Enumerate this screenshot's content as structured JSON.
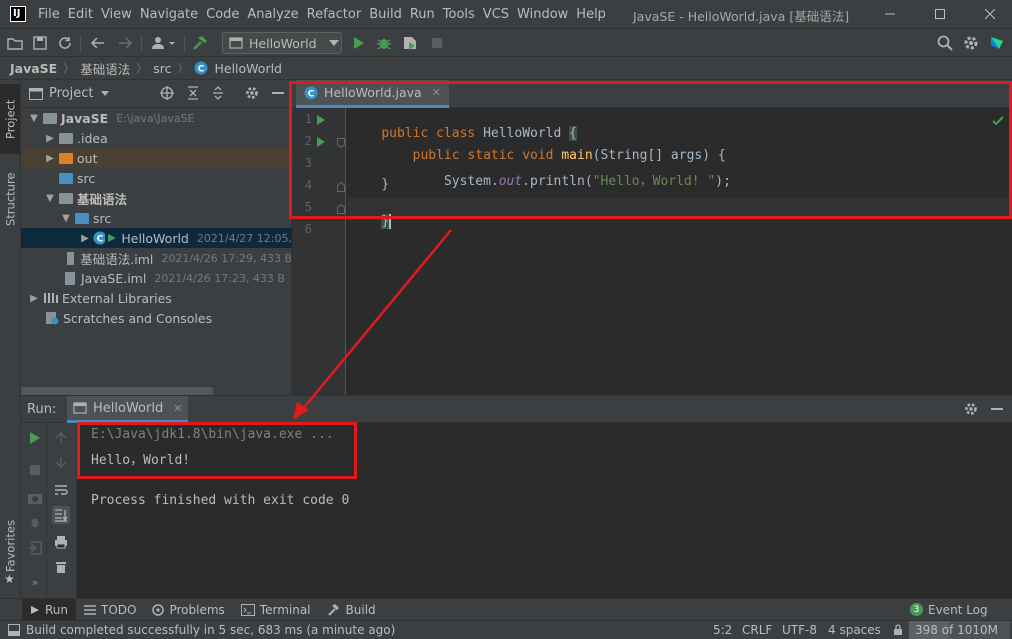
{
  "menu": {
    "items": [
      "File",
      "Edit",
      "View",
      "Navigate",
      "Code",
      "Analyze",
      "Refactor",
      "Build",
      "Run",
      "Tools",
      "VCS",
      "Window",
      "Help"
    ],
    "window_title": "JavaSE - HelloWorld.java [基础语法]"
  },
  "toolbar": {
    "run_config": "HelloWorld"
  },
  "breadcrumb": [
    "JavaSE",
    "基础语法",
    "src",
    "HelloWorld"
  ],
  "left_stripe": {
    "project": "Project",
    "structure": "Structure",
    "favorites": "Favorites"
  },
  "project": {
    "header": "Project",
    "rows": [
      {
        "name": "JavaSE",
        "meta": "E:\\java\\JavaSE"
      },
      {
        "name": ".idea",
        "meta": ""
      },
      {
        "name": "out",
        "meta": ""
      },
      {
        "name": "src",
        "meta": ""
      },
      {
        "name": "基础语法",
        "meta": ""
      },
      {
        "name": "src",
        "meta": ""
      },
      {
        "name": "HelloWorld",
        "meta": "2021/4/27 12:05,"
      },
      {
        "name": "基础语法.iml",
        "meta": "2021/4/26 17:29, 433 B"
      },
      {
        "name": "JavaSE.iml",
        "meta": "2021/4/26 17:23, 433 B"
      },
      {
        "name": "External Libraries",
        "meta": ""
      },
      {
        "name": "Scratches and Consoles",
        "meta": ""
      }
    ]
  },
  "editor": {
    "tab": "HelloWorld.java",
    "line_numbers": [
      "1",
      "2",
      "3",
      "4",
      "5",
      "6"
    ],
    "code": {
      "l1_kw": "public class ",
      "l1_name": "HelloWorld ",
      "l1_brace": "{",
      "l2_indent": "    ",
      "l2_kw": "public static void ",
      "l2_fn": "main",
      "l2_rest": "(String[] args) {",
      "l3_indent": "        ",
      "l3_sys": "System.",
      "l3_out": "out",
      "l3_call": ".println(",
      "l3_str": "\"Hello，World! \"",
      "l3_end": ");",
      "l4": "    }",
      "l5": "}"
    }
  },
  "run": {
    "label": "Run:",
    "tab": "HelloWorld",
    "lines": [
      "E:\\Java\\jdk1.8\\bin\\java.exe ...",
      "Hello，World!",
      "Process finished with exit code 0"
    ]
  },
  "bottom_tools": {
    "run": "Run",
    "todo": "TODO",
    "problems": "Problems",
    "terminal": "Terminal",
    "build": "Build",
    "event_log": "Event Log",
    "event_count": "3"
  },
  "status": {
    "message": "Build completed successfully in 5 sec, 683 ms (a minute ago)",
    "position": "5:2",
    "line_sep": "CRLF",
    "encoding": "UTF-8",
    "indent": "4 spaces",
    "memory": "398 of 1010M"
  },
  "colors": {
    "annotation_red": "#e01b1b",
    "run_green": "#499c54",
    "keyword": "#cc7832",
    "string": "#6a8759"
  }
}
